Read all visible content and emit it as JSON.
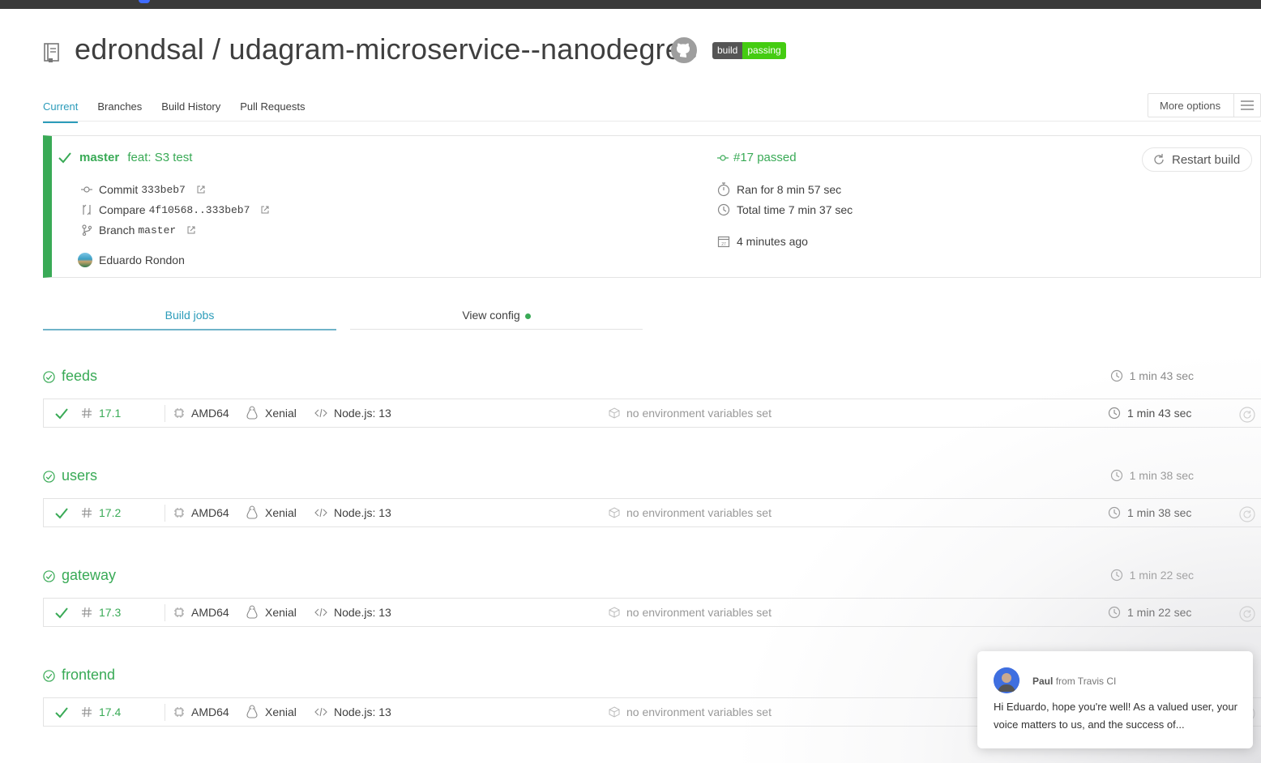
{
  "repo": {
    "owner": "edrondsal",
    "separator": " / ",
    "name": "udagram-microservice--nanodegree",
    "badge_left": "build",
    "badge_right": "passing"
  },
  "tabs": [
    "Current",
    "Branches",
    "Build History",
    "Pull Requests"
  ],
  "more_options": "More options",
  "build": {
    "branch": "master",
    "message": "feat: S3 test",
    "commit_label": "Commit",
    "commit_hash": "333beb7",
    "compare_label": "Compare",
    "compare_range": "4f10568..333beb7",
    "branch_label": "Branch",
    "branch_name": "master",
    "author": "Eduardo Rondon",
    "status": "#17 passed",
    "ran_for": "Ran for 8 min 57 sec",
    "total_time": "Total time 7 min 37 sec",
    "ago": "4 minutes ago",
    "restart": "Restart build"
  },
  "subtabs": {
    "jobs": "Build jobs",
    "config": "View config"
  },
  "jobs": [
    {
      "group": "feeds",
      "group_duration": "1 min 43 sec",
      "number": "17.1",
      "arch": "AMD64",
      "os": "Xenial",
      "lang": "Node.js: 13",
      "env": "no environment variables set",
      "duration": "1 min 43 sec"
    },
    {
      "group": "users",
      "group_duration": "1 min 38 sec",
      "number": "17.2",
      "arch": "AMD64",
      "os": "Xenial",
      "lang": "Node.js: 13",
      "env": "no environment variables set",
      "duration": "1 min 38 sec"
    },
    {
      "group": "gateway",
      "group_duration": "1 min 22 sec",
      "number": "17.3",
      "arch": "AMD64",
      "os": "Xenial",
      "lang": "Node.js: 13",
      "env": "no environment variables set",
      "duration": "1 min 22 sec"
    },
    {
      "group": "frontend",
      "group_duration": "",
      "number": "17.4",
      "arch": "AMD64",
      "os": "Xenial",
      "lang": "Node.js: 13",
      "env": "no environment variables set",
      "duration": ""
    }
  ],
  "chat": {
    "sender": "Paul",
    "from": "from Travis CI",
    "message": "Hi Eduardo, hope you're well! As a valued user, your voice matters to us, and the success of..."
  },
  "colors": {
    "success": "#39aa56",
    "link": "#2c9cba",
    "badge_pass": "#44cc11"
  }
}
